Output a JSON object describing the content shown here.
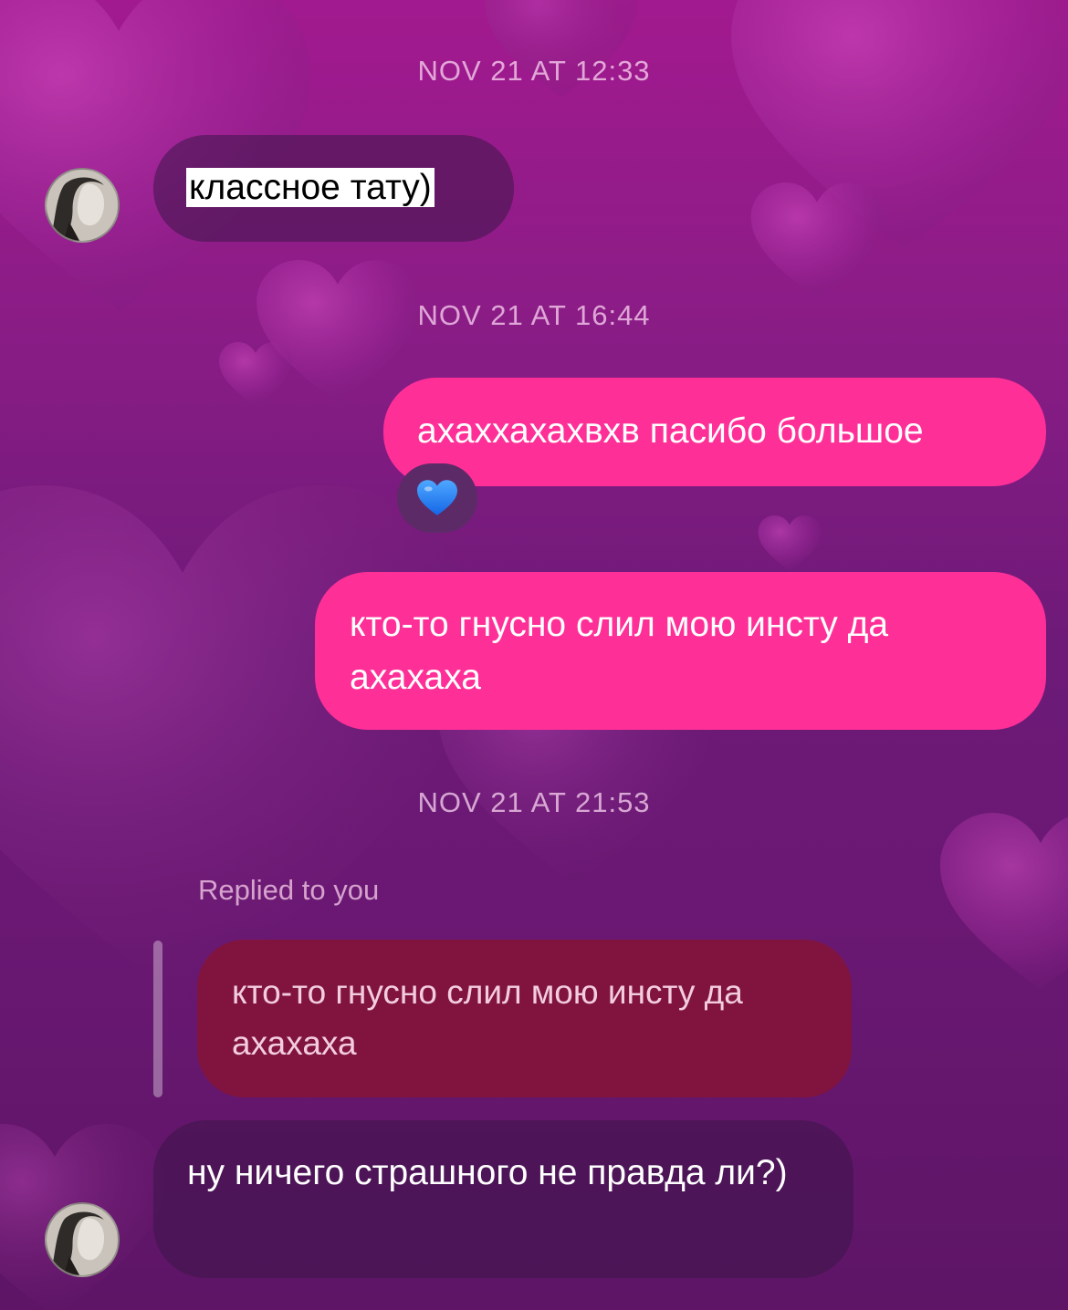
{
  "conversation": {
    "messages": [
      {
        "type": "timestamp",
        "text": "NOV 21 AT 12:33"
      },
      {
        "type": "received",
        "text": "классное тату)",
        "highlighted": true
      },
      {
        "type": "timestamp",
        "text": "NOV 21 AT 16:44"
      },
      {
        "type": "sent",
        "text": "ахаххахахвхв пасибо большое",
        "reaction": "💙"
      },
      {
        "type": "sent",
        "text": "кто-то гнусно слил мою инсту да ахахаха"
      },
      {
        "type": "timestamp",
        "text": "NOV 21 AT 21:53"
      },
      {
        "type": "reply_label",
        "text": "Replied to you"
      },
      {
        "type": "quoted",
        "text": "кто-то гнусно слил мою инсту да ахахаха"
      },
      {
        "type": "received",
        "text": "ну ничего страшного не правда ли?)"
      }
    ]
  },
  "colors": {
    "sent_bubble": "#ff2f98",
    "received_bubble": "rgba(60,22,72,0.55)",
    "quoted_bubble": "#80143f",
    "background_top": "#a21a8f",
    "background_bottom": "#5e1566"
  },
  "icons": {
    "avatar": "contact-avatar",
    "reaction": "blue-heart-emoji"
  }
}
